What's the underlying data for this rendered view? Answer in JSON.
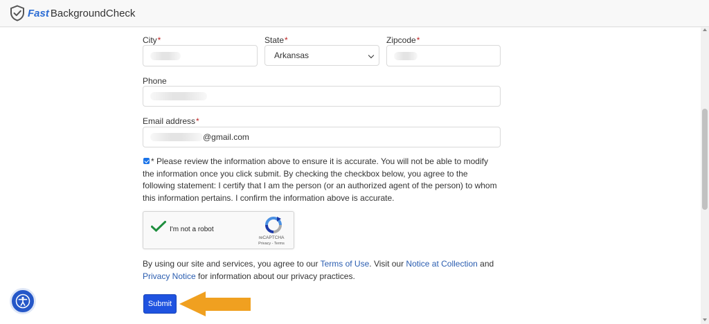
{
  "header": {
    "logo_fast": "Fast",
    "logo_rest": "BackgroundCheck",
    "icon": "shield-check-icon"
  },
  "form": {
    "city": {
      "label": "City",
      "required": "*",
      "value": ""
    },
    "state": {
      "label": "State",
      "required": "*",
      "value": "Arkansas"
    },
    "zipcode": {
      "label": "Zipcode",
      "required": "*",
      "value": ""
    },
    "phone": {
      "label": "Phone",
      "value": ""
    },
    "email": {
      "label": "Email address",
      "required": "*",
      "value_suffix": "@gmail.com"
    },
    "confirm_checked": true,
    "disclaimer": "* Please review the information above to ensure it is accurate. You will not be able to modify the information once you click submit. By checking the checkbox below, you agree to the following statement: I certify that I am the person (or an authorized agent of the person) to whom this information pertains. I confirm the information above is accurate.",
    "captcha": {
      "label": "I'm not a robot",
      "brand": "reCAPTCHA",
      "links": "Privacy - Terms",
      "checked": true
    },
    "policy": {
      "prefix": "By using our site and services, you agree to our ",
      "terms_link": "Terms of Use",
      "middle": ". Visit our ",
      "notice_link": "Notice at Collection",
      "and": " and ",
      "privacy_link": "Privacy Notice",
      "suffix": " for information about our privacy practices."
    },
    "submit_label": "Submit"
  },
  "colors": {
    "brand": "#2b6cd4",
    "submit": "#1f53e0",
    "arrow": "#f0a020",
    "link": "#2a5db0"
  },
  "accessibility_icon": "accessibility-icon"
}
